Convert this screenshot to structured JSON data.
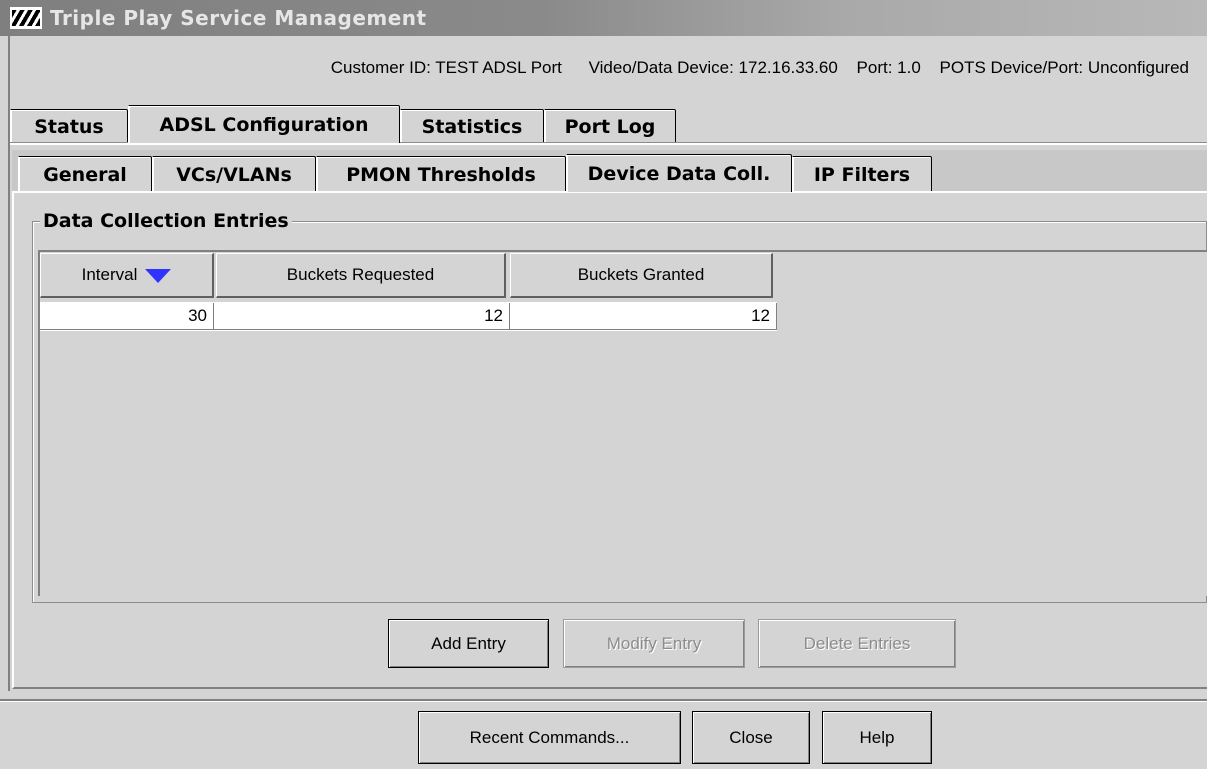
{
  "window": {
    "title": "Triple Play Service Management"
  },
  "info": {
    "customer": "Customer ID:  TEST ADSL Port",
    "device": "Video/Data Device:  172.16.33.60",
    "port": "Port:  1.0",
    "pots": "POTS Device/Port: Unconfigured"
  },
  "outer_tabs": [
    {
      "label": "Status"
    },
    {
      "label": "ADSL Configuration",
      "selected": true
    },
    {
      "label": "Statistics"
    },
    {
      "label": "Port Log"
    }
  ],
  "inner_tabs": [
    {
      "label": "General"
    },
    {
      "label": "VCs/VLANs"
    },
    {
      "label": "PMON Thresholds"
    },
    {
      "label": "Device Data Coll.",
      "selected": true
    },
    {
      "label": "IP Filters"
    }
  ],
  "group": {
    "title": "Data Collection Entries"
  },
  "table": {
    "columns": [
      "Interval",
      "Buckets Requested",
      "Buckets Granted"
    ],
    "sort_column": "Interval",
    "sort_direction": "descending",
    "rows": [
      [
        "30",
        "12",
        "12"
      ]
    ]
  },
  "entry_buttons": {
    "add": "Add Entry",
    "modify": "Modify Entry",
    "delete": "Delete Entries"
  },
  "footer_buttons": {
    "recent": "Recent Commands...",
    "close": "Close",
    "help": "Help"
  },
  "colors": {
    "sort_indicator": "#3232ff",
    "background": "#d4d4d4"
  }
}
